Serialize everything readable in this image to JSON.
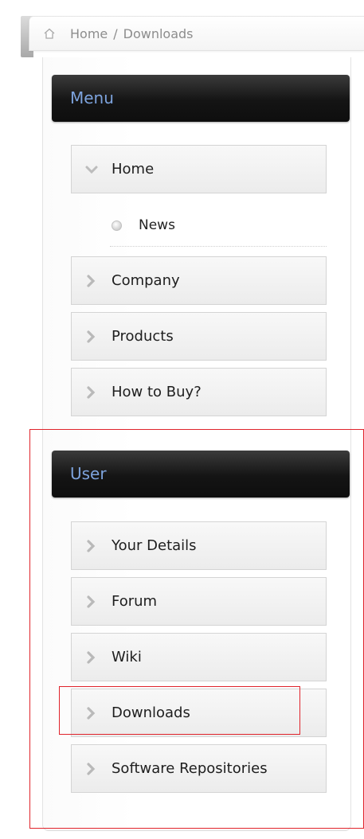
{
  "breadcrumb": {
    "home_icon": "home-icon",
    "home_label": "Home",
    "separator": "/",
    "current": "Downloads"
  },
  "menu_module": {
    "title": "Menu",
    "items": [
      {
        "label": "Home",
        "icon": "chevron-down-icon",
        "expanded": true
      },
      {
        "label": "Company",
        "icon": "chevron-right-icon"
      },
      {
        "label": "Products",
        "icon": "chevron-right-icon"
      },
      {
        "label": "How to Buy?",
        "icon": "chevron-right-icon"
      }
    ],
    "sub_items": [
      {
        "label": "News",
        "icon": "bullet-icon"
      }
    ]
  },
  "user_module": {
    "title": "User",
    "items": [
      {
        "label": "Your Details",
        "icon": "chevron-right-icon"
      },
      {
        "label": "Forum",
        "icon": "chevron-right-icon"
      },
      {
        "label": "Wiki",
        "icon": "chevron-right-icon"
      },
      {
        "label": "Downloads",
        "icon": "chevron-right-icon"
      },
      {
        "label": "Software Repositories",
        "icon": "chevron-right-icon"
      }
    ]
  },
  "colors": {
    "header_text": "#7da3dd",
    "annotation": "#e0232b"
  }
}
